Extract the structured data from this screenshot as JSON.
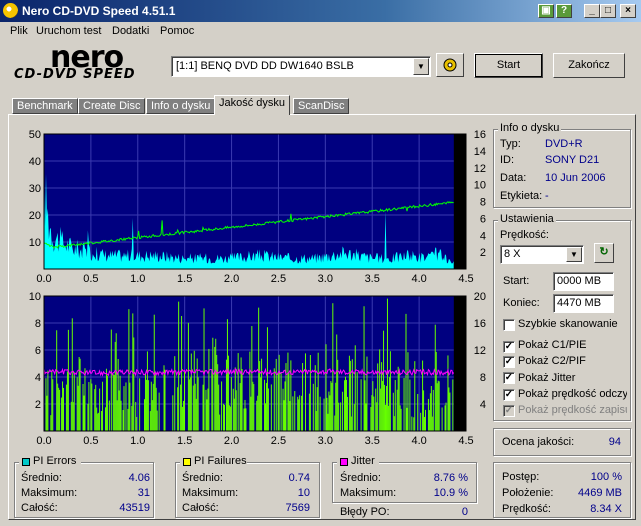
{
  "window": {
    "title": "Nero CD-DVD Speed 4.51.1"
  },
  "menu": [
    "Plik",
    "Uruchom test",
    "Dodatki",
    "Pomoc"
  ],
  "logo": {
    "brand": "nero",
    "product": "CD-DVD SPEED"
  },
  "toolbar": {
    "drive": "[1:1]  BENQ DVD DD DW1640 BSLB",
    "start_label": "Start",
    "end_label": "Zakończ"
  },
  "tabs": [
    "Benchmark",
    "Create Disc",
    "Info o dysku",
    "Jakość dysku",
    "ScanDisc"
  ],
  "active_tab": "Jakość dysku",
  "disc_info": {
    "title": "Info o dysku",
    "rows": [
      {
        "label": "Typ:",
        "value": "DVD+R"
      },
      {
        "label": "ID:",
        "value": "SONY D21"
      },
      {
        "label": "Data:",
        "value": "10 Jun 2006"
      },
      {
        "label": "Etykieta:",
        "value": "-"
      }
    ]
  },
  "settings": {
    "title": "Ustawienia",
    "speed_label": "Prędkość:",
    "speed_value": "8 X",
    "start_label": "Start:",
    "start_value": "0000 MB",
    "end_label": "Koniec:",
    "end_value": "4470 MB",
    "options": [
      {
        "label": "Szybkie skanowanie",
        "checked": false,
        "disabled": false
      },
      {
        "label": "Pokaż C1/PIE",
        "checked": true,
        "disabled": false
      },
      {
        "label": "Pokaż C2/PIF",
        "checked": true,
        "disabled": false
      },
      {
        "label": "Pokaż Jitter",
        "checked": true,
        "disabled": false
      },
      {
        "label": "Pokaż prędkość odczytu",
        "checked": true,
        "disabled": false
      },
      {
        "label": "Pokaż prędkość zapisu",
        "checked": true,
        "disabled": true
      }
    ]
  },
  "quality": {
    "label": "Ocena jakości:",
    "value": "94"
  },
  "pi_errors": {
    "title": "PI Errors",
    "color": "#00c8c8",
    "rows": [
      {
        "label": "Średnio:",
        "value": "4.06"
      },
      {
        "label": "Maksimum:",
        "value": "31"
      },
      {
        "label": "Całość:",
        "value": "43519"
      }
    ]
  },
  "pi_failures": {
    "title": "PI Failures",
    "color": "#ffff00",
    "rows": [
      {
        "label": "Średnio:",
        "value": "0.74"
      },
      {
        "label": "Maksimum:",
        "value": "10"
      },
      {
        "label": "Całość:",
        "value": "7569"
      }
    ]
  },
  "jitter": {
    "title": "Jitter",
    "color": "#ff00ff",
    "rows": [
      {
        "label": "Średnio:",
        "value": "8.76 %"
      },
      {
        "label": "Maksimum:",
        "value": "10.9 %"
      }
    ],
    "po_label": "Błędy PO:",
    "po_value": "0"
  },
  "progress": {
    "rows": [
      {
        "label": "Postęp:",
        "value": "100 %"
      },
      {
        "label": "Położenie:",
        "value": "4469 MB"
      },
      {
        "label": "Prędkość:",
        "value": "8.34 X"
      }
    ]
  },
  "chart_data": [
    {
      "type": "area",
      "name": "pi-errors-chart",
      "x_ticks": [
        "0.0",
        "0.5",
        "1.0",
        "1.5",
        "2.0",
        "2.5",
        "3.0",
        "3.5",
        "4.0",
        "4.5"
      ],
      "y_ticks_left": [
        "10",
        "20",
        "30",
        "40",
        "50"
      ],
      "y_ticks_right": [
        "2",
        "4",
        "6",
        "8",
        "10",
        "12",
        "14",
        "16"
      ],
      "xlim": [
        0,
        4.5
      ],
      "ylim_left": [
        0,
        50
      ],
      "ylim_right": [
        0,
        16
      ],
      "grid": true,
      "background": "#000080",
      "series": [
        {
          "color": "#00ffff",
          "x": [
            0.0,
            0.05,
            0.1,
            0.2,
            0.3,
            0.5,
            0.7,
            1.0,
            1.2,
            1.5,
            1.8,
            2.0,
            2.3,
            2.6,
            2.9,
            3.2,
            3.5,
            3.7,
            3.9,
            4.1,
            4.2,
            4.3,
            4.37
          ],
          "y": [
            30,
            18,
            12,
            10,
            8,
            6,
            5,
            5,
            5,
            4,
            4,
            4,
            5,
            4,
            4,
            6,
            4,
            4,
            5,
            4,
            6,
            3,
            2
          ]
        },
        {
          "color": "#00ff00",
          "axis": "right",
          "x": [
            0.0,
            0.1,
            4.37
          ],
          "y": [
            3.0,
            2.6,
            7.9
          ]
        }
      ]
    },
    {
      "type": "bar",
      "name": "pi-failures-chart",
      "x_ticks": [
        "0.0",
        "0.5",
        "1.0",
        "1.5",
        "2.0",
        "2.5",
        "3.0",
        "3.5",
        "4.0",
        "4.5"
      ],
      "y_ticks_left": [
        "2",
        "4",
        "6",
        "8",
        "10"
      ],
      "y_ticks_right": [
        "4",
        "8",
        "12",
        "16",
        "20"
      ],
      "xlim": [
        0,
        4.5
      ],
      "ylim_left": [
        0,
        10
      ],
      "ylim_right": [
        0,
        20
      ],
      "grid": true,
      "background": "#000080",
      "series": [
        {
          "color": "#66ff00",
          "x": [
            0.0,
            4.37
          ],
          "y": [
            2,
            2
          ],
          "max": 10
        },
        {
          "color": "#ff00ff",
          "axis": "right",
          "x": [
            0.0,
            0.5,
            1.0,
            1.5,
            2.0,
            2.5,
            3.0,
            3.5,
            4.0,
            4.37
          ],
          "y": [
            8.8,
            8.6,
            8.7,
            8.7,
            8.8,
            8.7,
            8.8,
            8.7,
            8.7,
            8.7
          ]
        }
      ]
    }
  ]
}
